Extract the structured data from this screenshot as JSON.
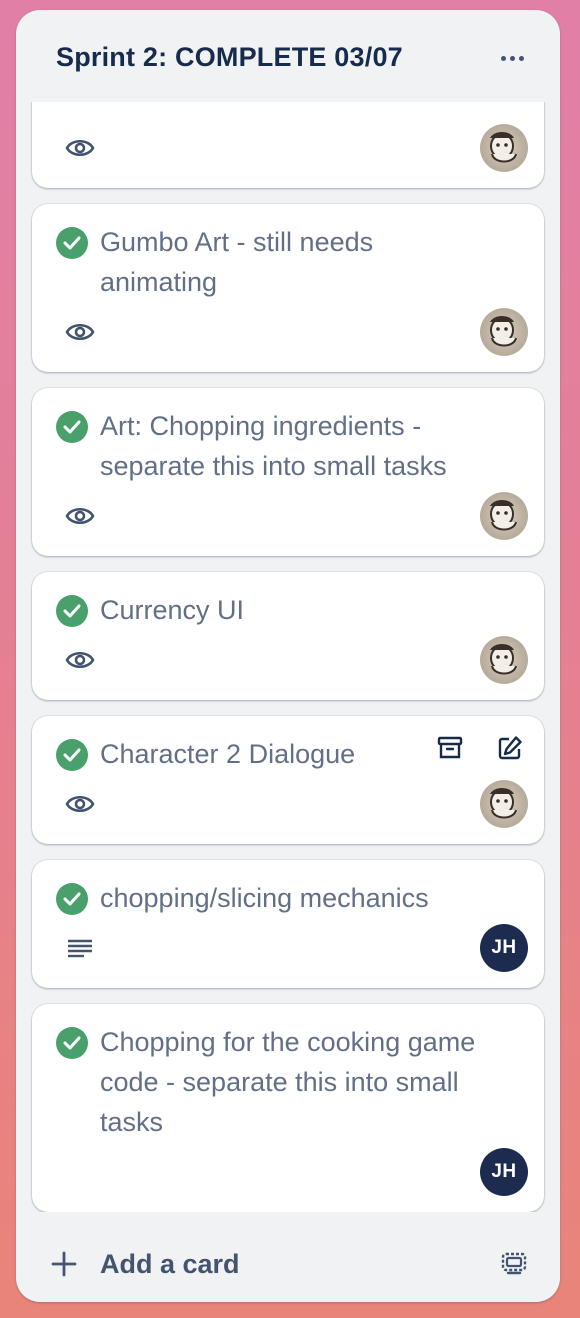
{
  "list": {
    "title": "Sprint 2: COMPLETE 03/07",
    "menu_icon": "more-horizontal-icon"
  },
  "cards": [
    {
      "title": "",
      "complete": true,
      "badges": [
        "eye-icon"
      ],
      "member": {
        "type": "photo",
        "initials": ""
      }
    },
    {
      "title": "Gumbo Art - still needs animating",
      "complete": true,
      "badges": [
        "eye-icon"
      ],
      "member": {
        "type": "photo",
        "initials": ""
      }
    },
    {
      "title": "Art: Chopping ingredients - separate this into small tasks",
      "complete": true,
      "badges": [
        "eye-icon"
      ],
      "member": {
        "type": "photo",
        "initials": ""
      }
    },
    {
      "title": "Currency UI",
      "complete": true,
      "badges": [
        "eye-icon"
      ],
      "member": {
        "type": "photo",
        "initials": ""
      }
    },
    {
      "title": "Character 2 Dialogue",
      "complete": true,
      "badges": [
        "eye-icon"
      ],
      "member": {
        "type": "photo",
        "initials": ""
      },
      "hover_actions": [
        "archive-icon",
        "edit-icon"
      ]
    },
    {
      "title": "chopping/slicing mechanics",
      "complete": true,
      "badges": [
        "description-icon"
      ],
      "member": {
        "type": "initials",
        "initials": "JH"
      }
    },
    {
      "title": "Chopping for the cooking game code - separate this into small tasks",
      "complete": true,
      "badges": [],
      "member": {
        "type": "initials",
        "initials": "JH"
      }
    }
  ],
  "footer": {
    "add_card_label": "Add a card",
    "add_icon": "plus-icon",
    "template_icon": "card-template-icon"
  },
  "colors": {
    "complete_green": "#4aa06a",
    "title_text": "#172b4d",
    "card_text": "#626f86",
    "avatar_navy": "#1d2b4f",
    "list_bg": "#f1f2f4"
  }
}
